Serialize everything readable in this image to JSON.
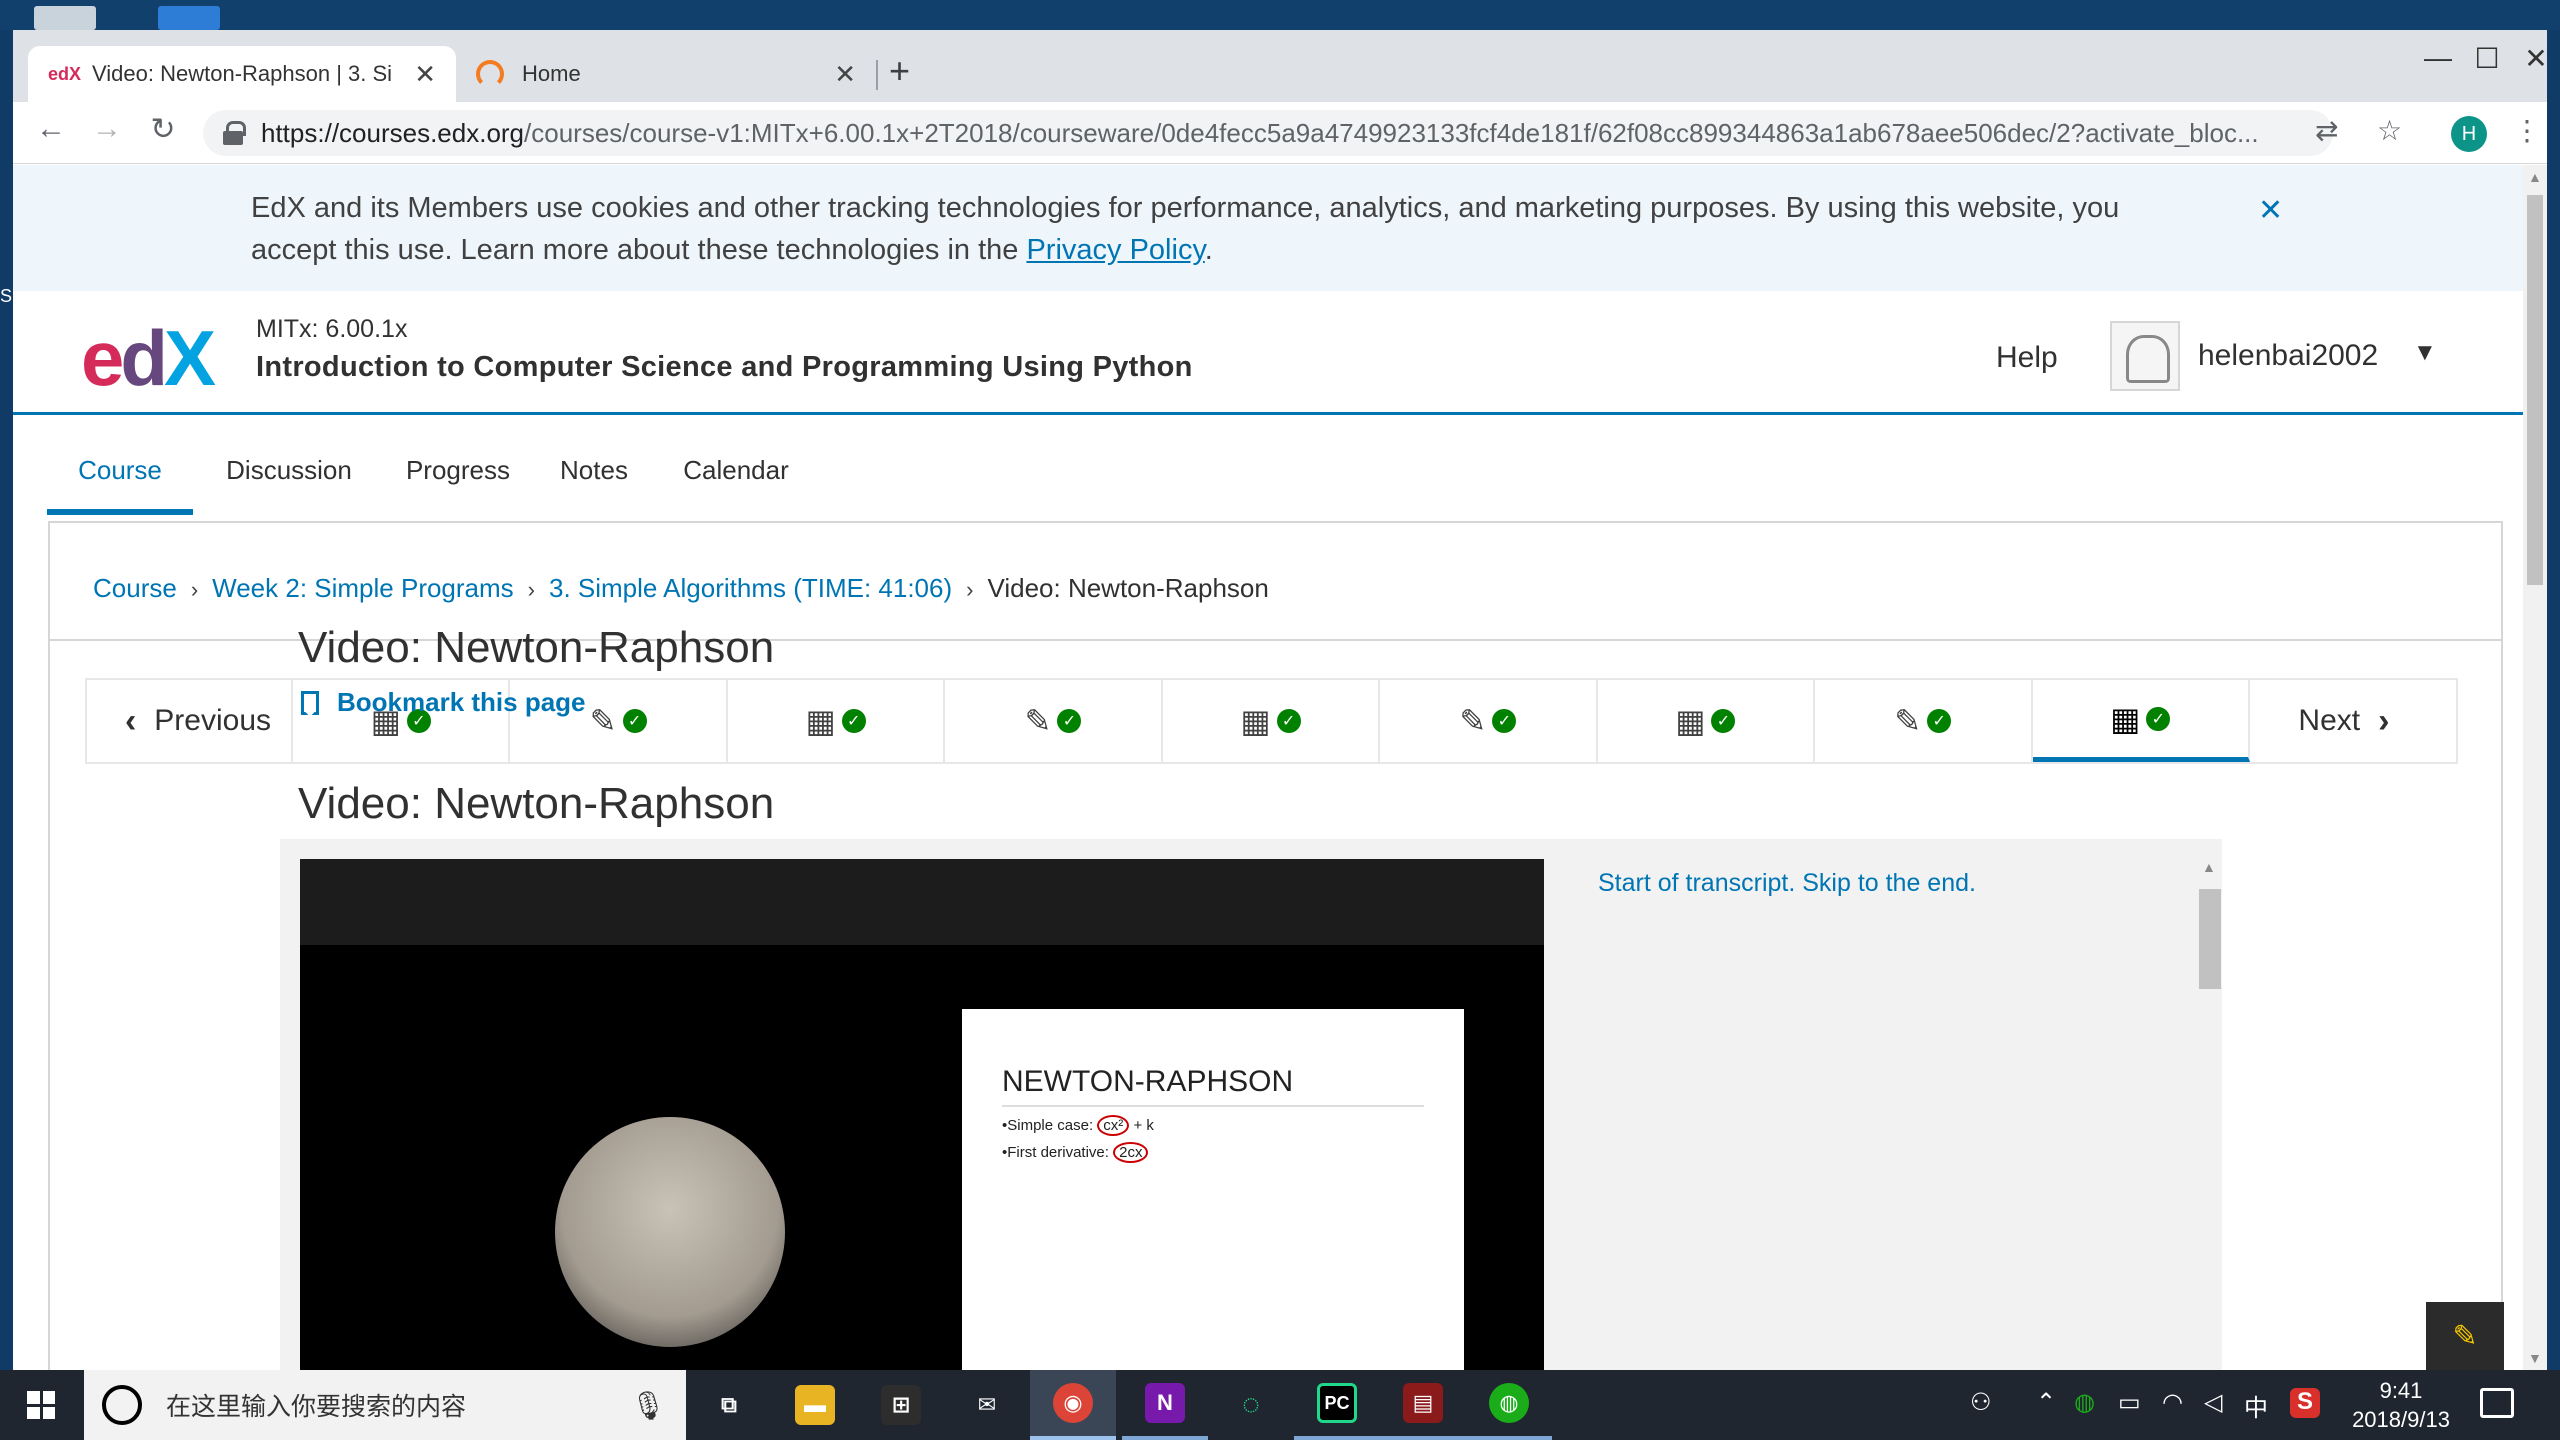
{
  "desktop": {
    "side_text": "S"
  },
  "browser": {
    "tabs": [
      {
        "favicon": "edX",
        "title": "Video: Newton-Raphson | 3. Si",
        "close": "✕"
      },
      {
        "favicon": "home-loading-icon",
        "title": "Home",
        "close": "✕"
      }
    ],
    "new_tab": "+",
    "window_controls": {
      "minimize": "—",
      "maximize": "☐",
      "close": "✕"
    },
    "url_host": "https://courses.edx.org",
    "url_path": "/courses/course-v1:MITx+6.00.1x+2T2018/courseware/0de4fecc5a9a4749923133fcf4de181f/62f08cc899344863a1ab678aee506dec/2?activate_bloc...",
    "profile_initial": "H"
  },
  "cookie_banner": {
    "text": "EdX and its Members use cookies and other tracking technologies for performance, analytics, and marketing purposes. By using this website, you accept this use. Learn more about these technologies in the ",
    "link": "Privacy Policy",
    "suffix": ".",
    "close": "✕"
  },
  "header": {
    "logo": {
      "e": "e",
      "d": "d",
      "x": "X"
    },
    "course_code": "MITx: 6.00.1x",
    "course_name": "Introduction to Computer Science and Programming Using Python",
    "help": "Help",
    "username": "helenbai2002",
    "caret": "▼"
  },
  "course_tabs": [
    {
      "label": "Course",
      "active": true
    },
    {
      "label": "Discussion"
    },
    {
      "label": "Progress"
    },
    {
      "label": "Notes"
    },
    {
      "label": "Calendar"
    }
  ],
  "breadcrumbs": [
    {
      "label": "Course",
      "link": true
    },
    {
      "label": "Week 2: Simple Programs",
      "link": true
    },
    {
      "label": "3. Simple Algorithms (TIME: 41:06)",
      "link": true
    },
    {
      "label": "Video: Newton-Raphson",
      "link": false
    }
  ],
  "sequence_nav": {
    "previous": "Previous",
    "next": "Next",
    "items": [
      {
        "type": "video",
        "complete": true
      },
      {
        "type": "problem",
        "complete": true
      },
      {
        "type": "video",
        "complete": true
      },
      {
        "type": "problem",
        "complete": true
      },
      {
        "type": "video",
        "complete": true
      },
      {
        "type": "problem",
        "complete": true
      },
      {
        "type": "video",
        "complete": true
      },
      {
        "type": "problem",
        "complete": true
      },
      {
        "type": "video",
        "complete": true,
        "active": true
      }
    ]
  },
  "unit": {
    "title": "Video: Newton-Raphson",
    "bookmark": "Bookmark this page",
    "video_heading": "Video: Newton-Raphson"
  },
  "video": {
    "slide_title": "NEWTON-RAPHSON",
    "slide_line1_pre": "•Simple case: ",
    "slide_line1_circ": "cx²",
    "slide_line1_post": " + k",
    "slide_line2_pre": "•First derivative: ",
    "slide_line2_circ": "2cx"
  },
  "transcript": {
    "start": "Start of transcript. Skip to the end."
  },
  "taskbar": {
    "search_placeholder": "在这里输入你要搜索的内容",
    "apps": [
      {
        "name": "task-view",
        "glyph": "⧉",
        "color": "#1f2630"
      },
      {
        "name": "file-explorer",
        "glyph": "▬",
        "color": "#e8b423"
      },
      {
        "name": "store",
        "glyph": "⊞",
        "color": "#2d2d2d"
      },
      {
        "name": "mail",
        "glyph": "✉",
        "color": "#1f2630"
      },
      {
        "name": "chrome",
        "glyph": "◉",
        "color": "#db4437"
      },
      {
        "name": "onenote",
        "glyph": "N",
        "color": "#7719aa"
      },
      {
        "name": "progress-app",
        "glyph": "◌",
        "color": "#1f2630"
      },
      {
        "name": "pycharm",
        "glyph": "PC",
        "color": "#21d789"
      },
      {
        "name": "winrar",
        "glyph": "▤",
        "color": "#8b1a1a"
      },
      {
        "name": "wechat",
        "glyph": "◍",
        "color": "#1aad19"
      }
    ],
    "tray_ime": "中",
    "time": "9:41",
    "date": "2018/9/13"
  },
  "colors": {
    "accent": "#0075b4",
    "complete": "#008100",
    "edx_red": "#d52b5a",
    "edx_blue": "#02a3e0"
  }
}
